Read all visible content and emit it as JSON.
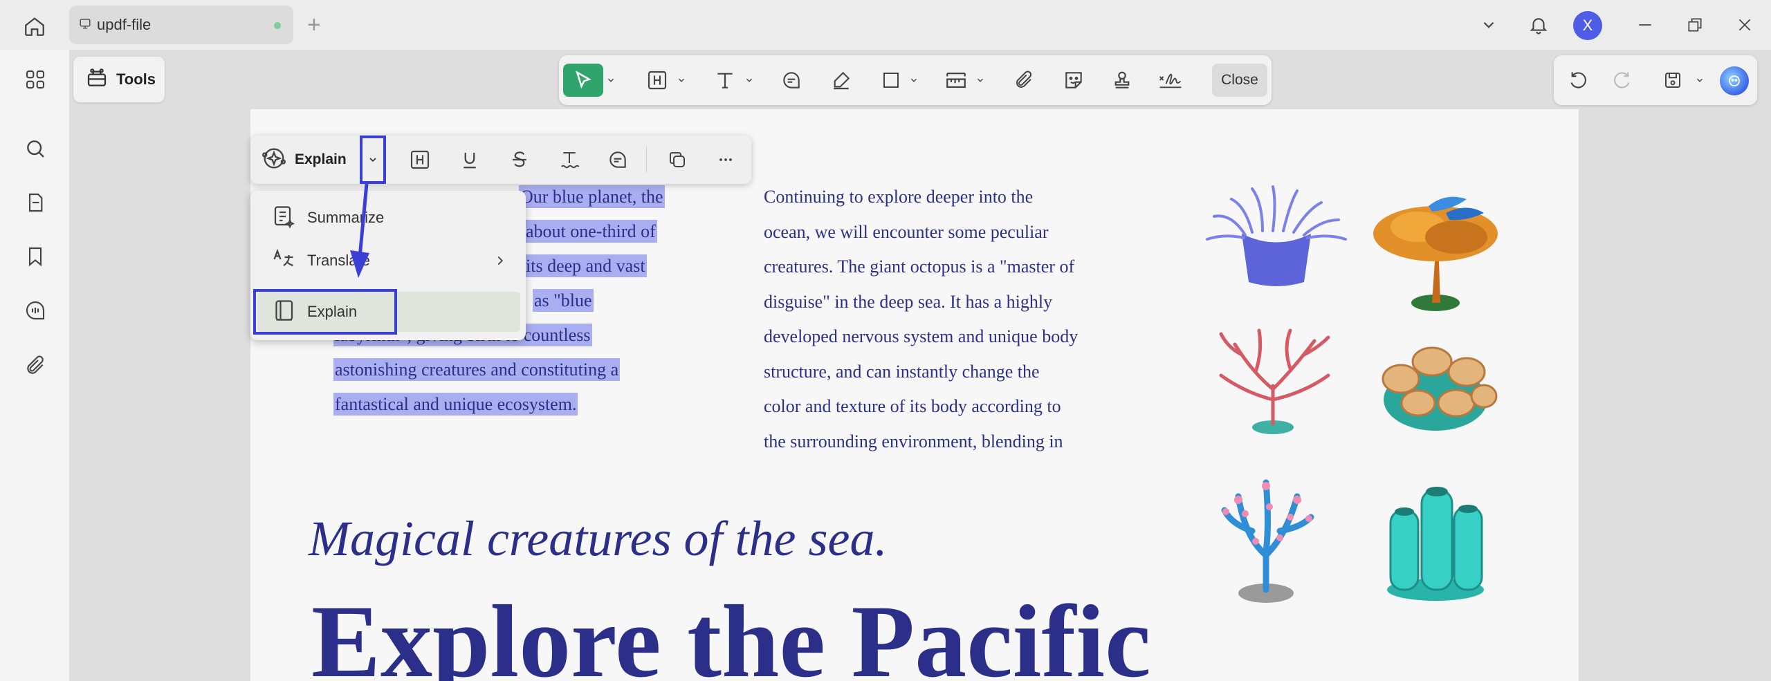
{
  "titlebar": {
    "tab_title": "updf-file",
    "avatar_letter": "X"
  },
  "tools": {
    "label": "Tools"
  },
  "main_toolbar": {
    "close_label": "Close",
    "accent_color": "#2fa56b"
  },
  "selection_toolbar": {
    "explain_label": "Explain",
    "highlight_color": "#3a3fd6"
  },
  "menu": {
    "items": [
      {
        "label": "Summarize",
        "icon": "summarize-icon"
      },
      {
        "label": "Translate",
        "icon": "translate-icon",
        "has_submenu": true
      },
      {
        "label": "Explain",
        "icon": "book-icon",
        "active": true
      }
    ]
  },
  "page": {
    "left_column": [
      "Our blue planet, the",
      "about one-third of",
      "its deep and vast",
      "as \"blue",
      "labyrinth\", giving birth to countless",
      "astonishing creatures and constituting a",
      "fantastical and unique ecosystem."
    ],
    "middle_column": [
      "Continuing to explore deeper into the",
      "ocean, we will encounter some peculiar",
      "creatures. The giant octopus is a \"master of",
      "disguise\" in the deep sea. It has a highly",
      "developed nervous system and unique body",
      "structure, and can instantly change the",
      "color and texture of its body according to",
      "the surrounding environment, blending in"
    ],
    "subheading": "Magical creatures of the sea.",
    "heading": "Explore the Pacific",
    "selection_color": "#a9aef0",
    "text_color": "#2c2f8a"
  }
}
